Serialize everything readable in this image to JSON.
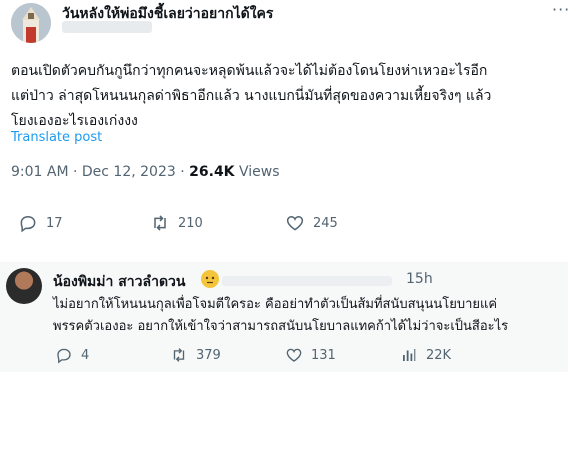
{
  "tweet": {
    "display_name": "วันหลังให้พ่อมึงชี้เลยว่าอยากได้ใคร",
    "body": "ตอนเปิดตัวคบกันกูนึกว่าทุกคนจะหลุดพ้นแล้วจะได้ไม่ต้องโดนโยงห่าเหวอะไรอีก\nแต่ป่าว ล่าสุดโหนนนกุลด่าพิธาอีกแล้ว นางแบกนี่มันที่สุดของความเหี้ยจริงๆ แล้ว\nโยงเองอะไรเองเก่งงง",
    "translate": "Translate post",
    "time": "9:01 AM · Dec 12, 2023 · ",
    "views_count": "26.4K",
    "views_label": " Views",
    "replies": "17",
    "reposts": "210",
    "likes": "245"
  },
  "reply": {
    "display_name": "น้องพิมม่า สาวลำดวน",
    "time": "15h",
    "body": "ไม่อยากให้โหนนนกุลเพื่อโจมตีใครอะ คืออย่าทำตัวเป็นส้มที่สนับสนุนนโยบายแค่\nพรรคตัวเองอะ อยากให้เข้าใจว่าสามารถสนับนโยบาลแทคก้าได้ไม่ว่าจะเป็นสีอะไร",
    "replies": "4",
    "reposts": "379",
    "likes": "131",
    "views": "22K"
  },
  "icons": [
    "more-icon",
    "reply-icon",
    "repost-icon",
    "like-icon",
    "views-icon",
    "emoji-icon"
  ],
  "colors": {
    "link": "#1d9bf0",
    "muted": "#536471",
    "text": "#0f1419"
  }
}
